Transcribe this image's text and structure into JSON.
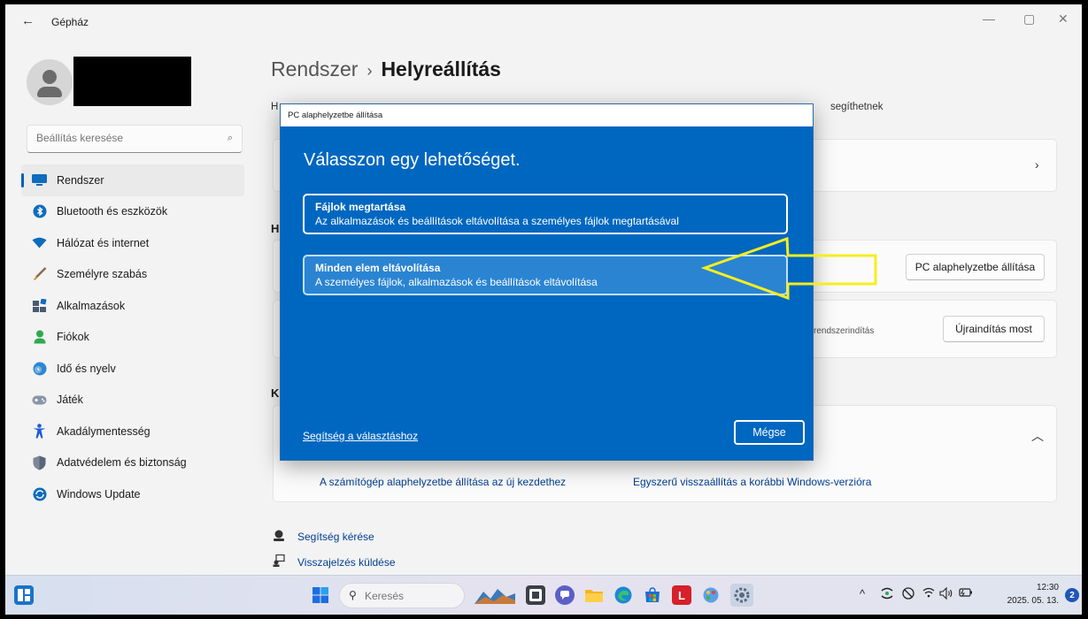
{
  "window": {
    "title": "Gépház",
    "back_icon": "back-arrow-icon",
    "minimize": "—",
    "maximize": "▢",
    "close": "✕"
  },
  "sidebar": {
    "search_placeholder": "Beállítás keresése",
    "search_icon": "⌕",
    "items": [
      {
        "label": "Rendszer",
        "icon": "system-icon",
        "active": true
      },
      {
        "label": "Bluetooth és eszközök",
        "icon": "bluetooth-icon"
      },
      {
        "label": "Hálózat és internet",
        "icon": "wifi-icon"
      },
      {
        "label": "Személyre szabás",
        "icon": "brush-icon"
      },
      {
        "label": "Alkalmazások",
        "icon": "apps-icon"
      },
      {
        "label": "Fiókok",
        "icon": "person-icon"
      },
      {
        "label": "Idő és nyelv",
        "icon": "globe-clock-icon"
      },
      {
        "label": "Játék",
        "icon": "gamepad-icon"
      },
      {
        "label": "Akadálymentesség",
        "icon": "accessibility-icon"
      },
      {
        "label": "Adatvédelem és biztonság",
        "icon": "shield-icon"
      },
      {
        "label": "Windows Update",
        "icon": "update-icon"
      }
    ]
  },
  "main": {
    "breadcrumb_parent": "Rendszer",
    "breadcrumb_separator": "›",
    "breadcrumb_current": "Helyreállítás",
    "description_start": "H",
    "description_end": "segíthetnek",
    "section_h1": "H",
    "section_k": "K",
    "reset_button": "PC alaphelyzetbe állítása",
    "advanced_startup_text": "rendszerindítás",
    "restart_button": "Újraindítás most",
    "chevron_right": "›",
    "chevron_up": "︿",
    "link_reset_fresh": "A számítógép alaphelyzetbe állítása az új kezdethez",
    "link_go_back": "Egyszerű visszaállítás a korábbi Windows-verzióra",
    "help_get": "Segítség kérése",
    "help_feedback": "Visszajelzés küldése"
  },
  "dialog": {
    "title": "PC alaphelyzetbe állítása",
    "heading": "Válasszon egy lehetőséget.",
    "options": [
      {
        "title": "Fájlok megtartása",
        "desc": "Az alkalmazások és beállítások eltávolítása a személyes fájlok megtartásával"
      },
      {
        "title": "Minden elem eltávolítása",
        "desc": "A személyes fájlok, alkalmazások és beállítások eltávolítása"
      }
    ],
    "help_link": "Segítség a választáshoz",
    "cancel": "Mégse"
  },
  "taskbar": {
    "search_label": "Keresés",
    "time": "12:30",
    "date": "2025. 05. 13.",
    "notification_count": "2",
    "accent": "#0067c0"
  }
}
